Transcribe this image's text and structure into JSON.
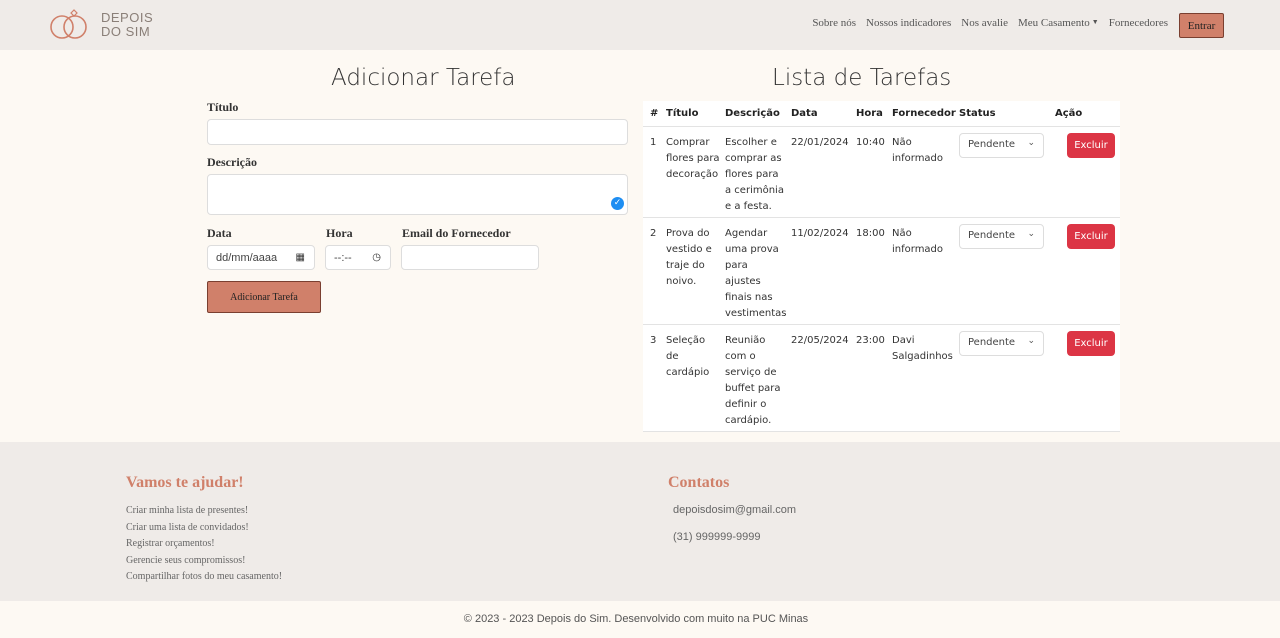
{
  "brand": {
    "line1": "DEPOIS",
    "line2": "DO SIM"
  },
  "nav": {
    "items": [
      "Sobre nós",
      "Nossos indicadores",
      "Nos avalie",
      "Meu Casamento",
      "Fornecedores"
    ],
    "login": "Entrar"
  },
  "form": {
    "heading": "Adicionar Tarefa",
    "title_label": "Título",
    "title_value": "",
    "desc_label": "Descrição",
    "desc_value": "",
    "date_label": "Data",
    "date_placeholder": "dd/mm/aaaa",
    "time_label": "Hora",
    "time_placeholder": "--:--",
    "email_label": "Email do Fornecedor",
    "email_value": "",
    "submit": "Adicionar Tarefa"
  },
  "tasks": {
    "heading": "Lista de Tarefas",
    "columns": [
      "#",
      "Título",
      "Descrição",
      "Data",
      "Hora",
      "Fornecedor",
      "Status",
      "Ação"
    ],
    "rows": [
      {
        "n": "1",
        "title": "Comprar flores para decoração",
        "desc": "Escolher e comprar as flores para a cerimônia e a festa.",
        "date": "22/01/2024",
        "time": "10:40",
        "vendor": "Não informado",
        "status": "Pendente",
        "action": "Excluir"
      },
      {
        "n": "2",
        "title": "Prova do vestido e traje do noivo.",
        "desc": "Agendar uma prova para ajustes finais nas vestimentas",
        "date": "11/02/2024",
        "time": "18:00",
        "vendor": "Não informado",
        "status": "Pendente",
        "action": "Excluir"
      },
      {
        "n": "3",
        "title": "Seleção de cardápio",
        "desc": "Reunião com o serviço de buffet para definir o cardápio.",
        "date": "22/05/2024",
        "time": "23:00",
        "vendor": "Davi Salgadinhos",
        "status": "Pendente",
        "action": "Excluir"
      }
    ]
  },
  "footer": {
    "help_title": "Vamos te ajudar!",
    "help_links": [
      "Criar minha lista de presentes!",
      "Criar uma lista de convidados!",
      "Registrar orçamentos!",
      "Gerencie seus compromissos!",
      "Compartilhar fotos do meu casamento!"
    ],
    "contact_title": "Contatos",
    "email": "depoisdosim@gmail.com",
    "phone": "(31) 999999-9999",
    "copyright": "© 2023 - 2023 Depois do Sim. Desenvolvido com muito na PUC Minas"
  },
  "colors": {
    "accent": "#d0806a",
    "danger": "#dc3545",
    "background": "#fdf9f3",
    "navbar": "#efebe8"
  },
  "icons": {
    "logo": "interlocked-rings-icon",
    "date": "calendar-icon",
    "time": "clock-icon",
    "select": "chevron-down-icon",
    "textarea": "check-circle-icon"
  }
}
